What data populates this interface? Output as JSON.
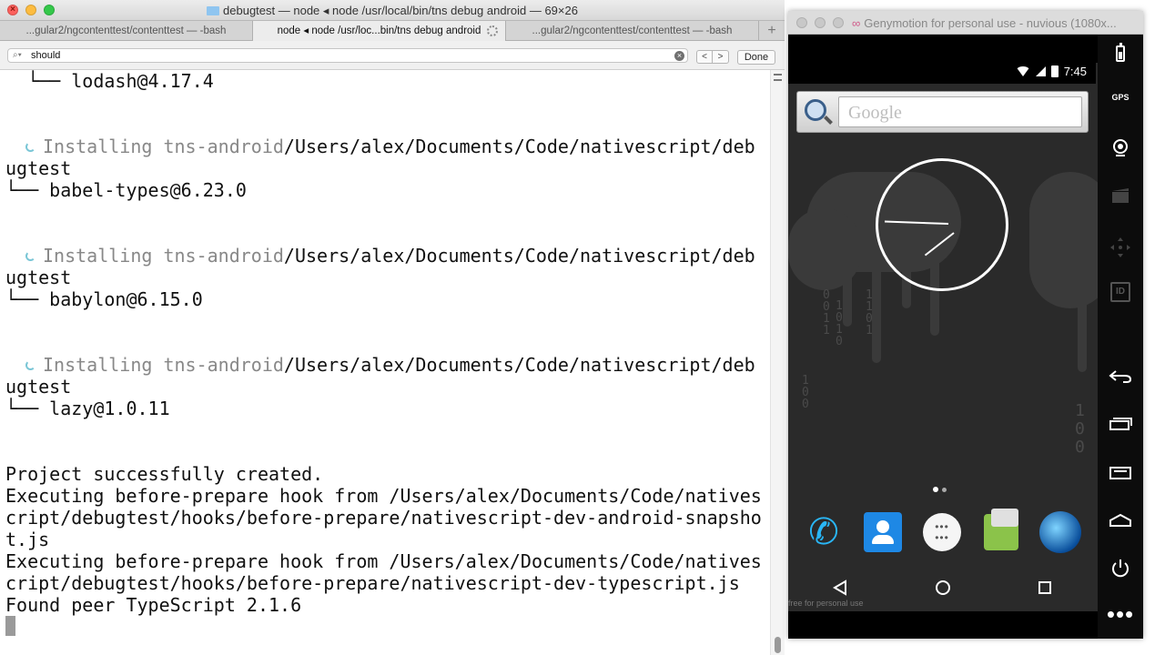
{
  "terminal": {
    "title": "debugtest — node ◂ node /usr/local/bin/tns debug android — 69×26",
    "tabs": [
      "...gular2/ngcontenttest/contenttest — -bash",
      "node ◂ node /usr/loc...bin/tns debug android",
      "...gular2/ngcontenttest/contenttest — -bash"
    ],
    "new_tab_label": "+",
    "find": {
      "query": "should",
      "prev_label": "<",
      "next_label": ">",
      "done_label": "Done"
    },
    "lines": {
      "l1": "└── lodash@4.17.4",
      "install_prefix": "Installing tns-android",
      "install_path": "/Users/alex/Documents/Code/nativescript/deb",
      "install_wrap": "ugtest",
      "pkg_babel_types": "└── babel-types@6.23.0",
      "pkg_babylon": "└── babylon@6.15.0",
      "pkg_lazy": "└── lazy@1.0.11",
      "created": "Project successfully created.",
      "hook1_a": "Executing before-prepare hook from /Users/alex/Documents/Code/natives",
      "hook1_b": "cript/debugtest/hooks/before-prepare/nativescript-dev-android-snapsho",
      "hook1_c": "t.js",
      "hook2_a": "Executing before-prepare hook from /Users/alex/Documents/Code/natives",
      "hook2_b": "cript/debugtest/hooks/before-prepare/nativescript-dev-typescript.js",
      "peer": "Found peer TypeScript 2.1.6"
    }
  },
  "genymotion": {
    "title": "Genymotion for personal use - nuvious (1080x...",
    "status_time": "7:45",
    "search_placeholder": "Google",
    "watermark": "free for personal use",
    "sidebar": {
      "gps_label": "GPS",
      "id_label": "ID",
      "more_label": "•••"
    },
    "drawer_dots": "•••\n•••",
    "digits_a": "0\n0\n1\n1",
    "digits_b": "1\n0\n1\n0",
    "digits_c": "1\n1\n0\n1",
    "digits_d": "1\n0\n0",
    "digits_e": "1\n0\n0"
  }
}
